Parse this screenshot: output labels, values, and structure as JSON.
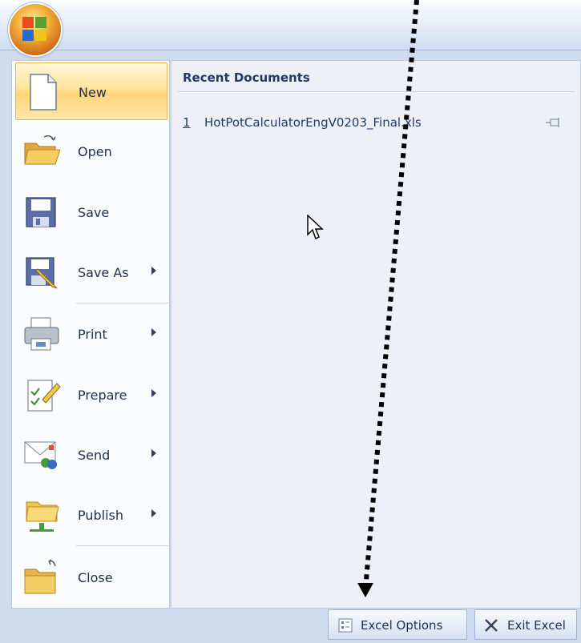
{
  "menu": {
    "items": [
      {
        "label": "New",
        "icon": "new-document-icon",
        "submenu": false,
        "selected": true
      },
      {
        "label": "Open",
        "icon": "open-folder-icon",
        "submenu": false
      },
      {
        "label": "Save",
        "icon": "save-floppy-icon",
        "submenu": false
      },
      {
        "label": "Save As",
        "icon": "save-as-icon",
        "submenu": true
      },
      {
        "label": "Print",
        "icon": "printer-icon",
        "submenu": true
      },
      {
        "label": "Prepare",
        "icon": "prepare-icon",
        "submenu": true
      },
      {
        "label": "Send",
        "icon": "send-icon",
        "submenu": true
      },
      {
        "label": "Publish",
        "icon": "publish-icon",
        "submenu": true
      },
      {
        "label": "Close",
        "icon": "close-folder-icon",
        "submenu": false
      }
    ]
  },
  "recent": {
    "title": "Recent Documents",
    "items": [
      {
        "number": "1",
        "name": "HotPotCalculatorEngV0203_Final.xls"
      }
    ]
  },
  "footer": {
    "options_label": "Excel Options",
    "exit_label": "Exit Excel"
  },
  "colors": {
    "selected_highlight": "#ffd57a",
    "frame_blue": "#cfdcef",
    "text_dark_blue": "#1f3a68"
  }
}
